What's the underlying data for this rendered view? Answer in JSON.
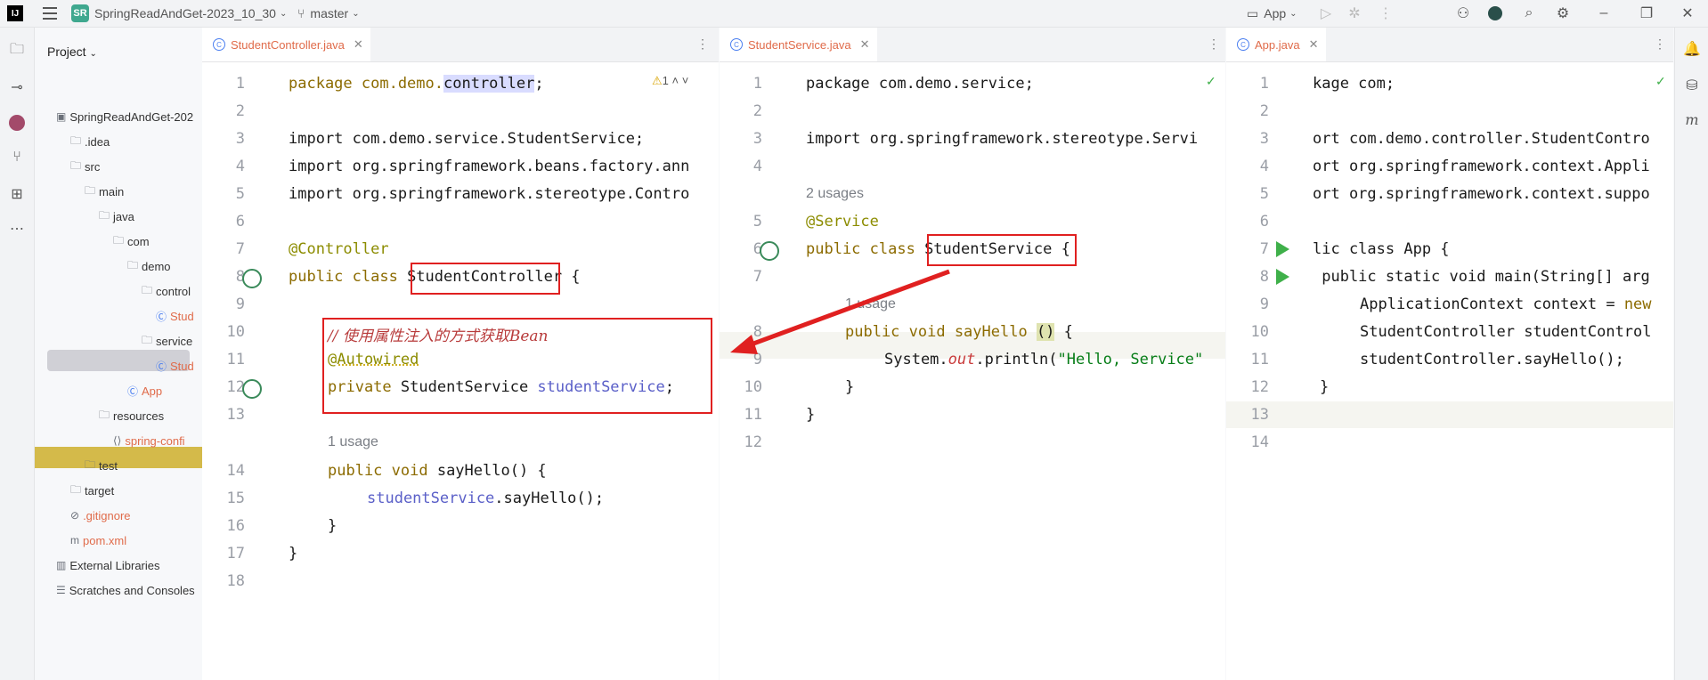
{
  "title_bar": {
    "logo": "IJ",
    "project_badge": "SR",
    "project_name": "SpringReadAndGet-2023_10_30",
    "branch": "master",
    "run_config": "App"
  },
  "project_panel": {
    "header": "Project",
    "tree": [
      {
        "label": "SpringReadAndGet-202",
        "indent": 0,
        "icon": "module-icon"
      },
      {
        "label": ".idea",
        "indent": 1,
        "icon": "folder-icon"
      },
      {
        "label": "src",
        "indent": 1,
        "icon": "folder-icon"
      },
      {
        "label": "main",
        "indent": 2,
        "icon": "folder-icon"
      },
      {
        "label": "java",
        "indent": 3,
        "icon": "folder-icon"
      },
      {
        "label": "com",
        "indent": 4,
        "icon": "package-icon"
      },
      {
        "label": "demo",
        "indent": 5,
        "icon": "package-icon"
      },
      {
        "label": "control",
        "indent": 6,
        "icon": "package-icon"
      },
      {
        "label": "Stud",
        "indent": 7,
        "icon": "class-icon"
      },
      {
        "label": "service",
        "indent": 6,
        "icon": "package-icon"
      },
      {
        "label": "Stud",
        "indent": 7,
        "icon": "class-icon"
      },
      {
        "label": "App",
        "indent": 5,
        "icon": "class-icon"
      },
      {
        "label": "resources",
        "indent": 3,
        "icon": "folder-icon"
      },
      {
        "label": "spring-confi",
        "indent": 4,
        "icon": "xml-icon"
      },
      {
        "label": "test",
        "indent": 2,
        "icon": "folder-icon"
      },
      {
        "label": "target",
        "indent": 1,
        "icon": "folder-icon"
      },
      {
        "label": ".gitignore",
        "indent": 1,
        "icon": "ignore-icon"
      },
      {
        "label": "pom.xml",
        "indent": 1,
        "icon": "maven-icon"
      },
      {
        "label": "External Libraries",
        "indent": 0,
        "icon": "library-icon"
      },
      {
        "label": "Scratches and Consoles",
        "indent": 0,
        "icon": "scratch-icon"
      }
    ]
  },
  "editors": {
    "left": {
      "tab": "StudentController.java",
      "warning": "1",
      "lines": [
        "1",
        "2",
        "3",
        "4",
        "5",
        "6",
        "7",
        "8",
        "9",
        "10",
        "11",
        "12",
        "13",
        "14",
        "15",
        "16",
        "17",
        "18"
      ],
      "code": {
        "l1a": "package com.demo.",
        "l1b": "controller",
        "l1c": ";",
        "l3": "import com.demo.service.StudentService;",
        "l4": "import org.springframework.beans.factory.ann",
        "l5": "import org.springframework.stereotype.Contro",
        "l7": "@Controller",
        "l8a": "public class ",
        "l8b": "StudentController",
        "l8c": " {",
        "l10": "// 使用属性注入的方式获取Bean",
        "l11": "@Autowired",
        "l12a": "private StudentService ",
        "l12b": "studentService",
        ";": ";",
        "usage": "1 usage",
        "l14": "public void sayHello() {",
        "l15a": "studentService",
        ".": ".sayHello();",
        "l16": "}",
        "l17": "}"
      }
    },
    "middle": {
      "tab": "StudentService.java",
      "lines": [
        "1",
        "2",
        "3",
        "4",
        "5",
        "6",
        "7",
        "8",
        "9",
        "10",
        "11",
        "12"
      ],
      "code": {
        "l1": "package com.demo.service;",
        "l3": "import org.springframework.stereotype.Servi",
        "usages": "2 usages",
        "l5": "@Service",
        "l6a": "public class ",
        "l6b": "StudentService",
        "l6c": " {",
        "usage": "1 usage",
        "l8a": "public void sayHello ",
        "l8b": "()",
        "l8c": " {",
        "l9a": "System.",
        "l9b": "out",
        "l9c": ".println(",
        "l9d": "\"Hello, Service\"",
        "l10": "}",
        "l11": "}"
      }
    },
    "right": {
      "tab": "App.java",
      "lines": [
        "1",
        "2",
        "3",
        "4",
        "5",
        "6",
        "7",
        "8",
        "9",
        "10",
        "11",
        "12",
        "13",
        "14"
      ],
      "code": {
        "l1": "kage com;",
        "l3": "ort com.demo.controller.StudentContro",
        "l4": "ort org.springframework.context.Appli",
        "l5": "ort org.springframework.context.suppo",
        "l7": "lic class App {",
        "l8": " public static void main(String[] arg",
        "l9a": "ApplicationContext context = ",
        "l9b": "new",
        "l10": "StudentController studentControl",
        "l11": "studentController.sayHello();",
        "l12": "}"
      }
    }
  },
  "colors": {
    "accent": "#e02020",
    "tab_text": "#e06b4a",
    "keyword": "#0033b3"
  }
}
